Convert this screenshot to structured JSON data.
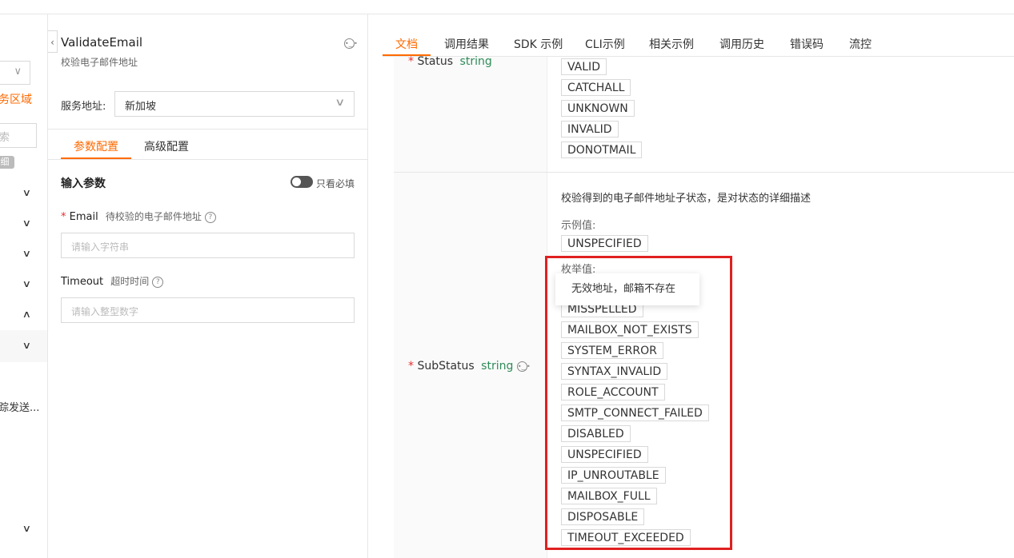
{
  "strip": {
    "region_text": "务区域",
    "search_placeholder": "索",
    "tag_text": "细",
    "truncated_text": "踪发送..."
  },
  "api": {
    "name": "ValidateEmail",
    "description": "校验电子邮件地址",
    "service_label": "服务地址:",
    "service_value": "新加坡"
  },
  "mid_tabs": [
    {
      "label": "参数配置",
      "active": true
    },
    {
      "label": "高级配置",
      "active": false
    }
  ],
  "params": {
    "title": "输入参数",
    "toggle_label": "只看必填",
    "items": [
      {
        "required": "*",
        "name": "Email",
        "desc": "待校验的电子邮件地址",
        "placeholder": "请输入字符串"
      },
      {
        "required": "",
        "name": "Timeout",
        "desc": "超时时间",
        "placeholder": "请输入整型数字"
      }
    ]
  },
  "right_tabs": [
    "文档",
    "调用结果",
    "SDK 示例",
    "CLI示例",
    "相关示例",
    "调用历史",
    "错误码",
    "流控"
  ],
  "doc": {
    "status": {
      "required": "*",
      "name": "Status",
      "type": "string",
      "enum": [
        "VALID",
        "CATCHALL",
        "UNKNOWN",
        "INVALID",
        "DONOTMAIL"
      ]
    },
    "substatus": {
      "required": "*",
      "name": "SubStatus",
      "type": "string",
      "description": "校验得到的电子邮件地址子状态，是对状态的详细描述",
      "example_label": "示例值:",
      "example": "UNSPECIFIED",
      "enum_label": "枚举值:",
      "enum": [
        "MISSPELLED",
        "MAILBOX_NOT_EXISTS",
        "SYSTEM_ERROR",
        "SYNTAX_INVALID",
        "ROLE_ACCOUNT",
        "SMTP_CONNECT_FAILED",
        "DISABLED",
        "UNSPECIFIED",
        "IP_UNROUTABLE",
        "MAILBOX_FULL",
        "DISPOSABLE",
        "TIMEOUT_EXCEEDED"
      ],
      "tooltip": "无效地址，邮箱不存在"
    }
  },
  "colors": {
    "accent": "#ff6a00",
    "type": "#2e8b57",
    "highlight": "#e02020"
  }
}
